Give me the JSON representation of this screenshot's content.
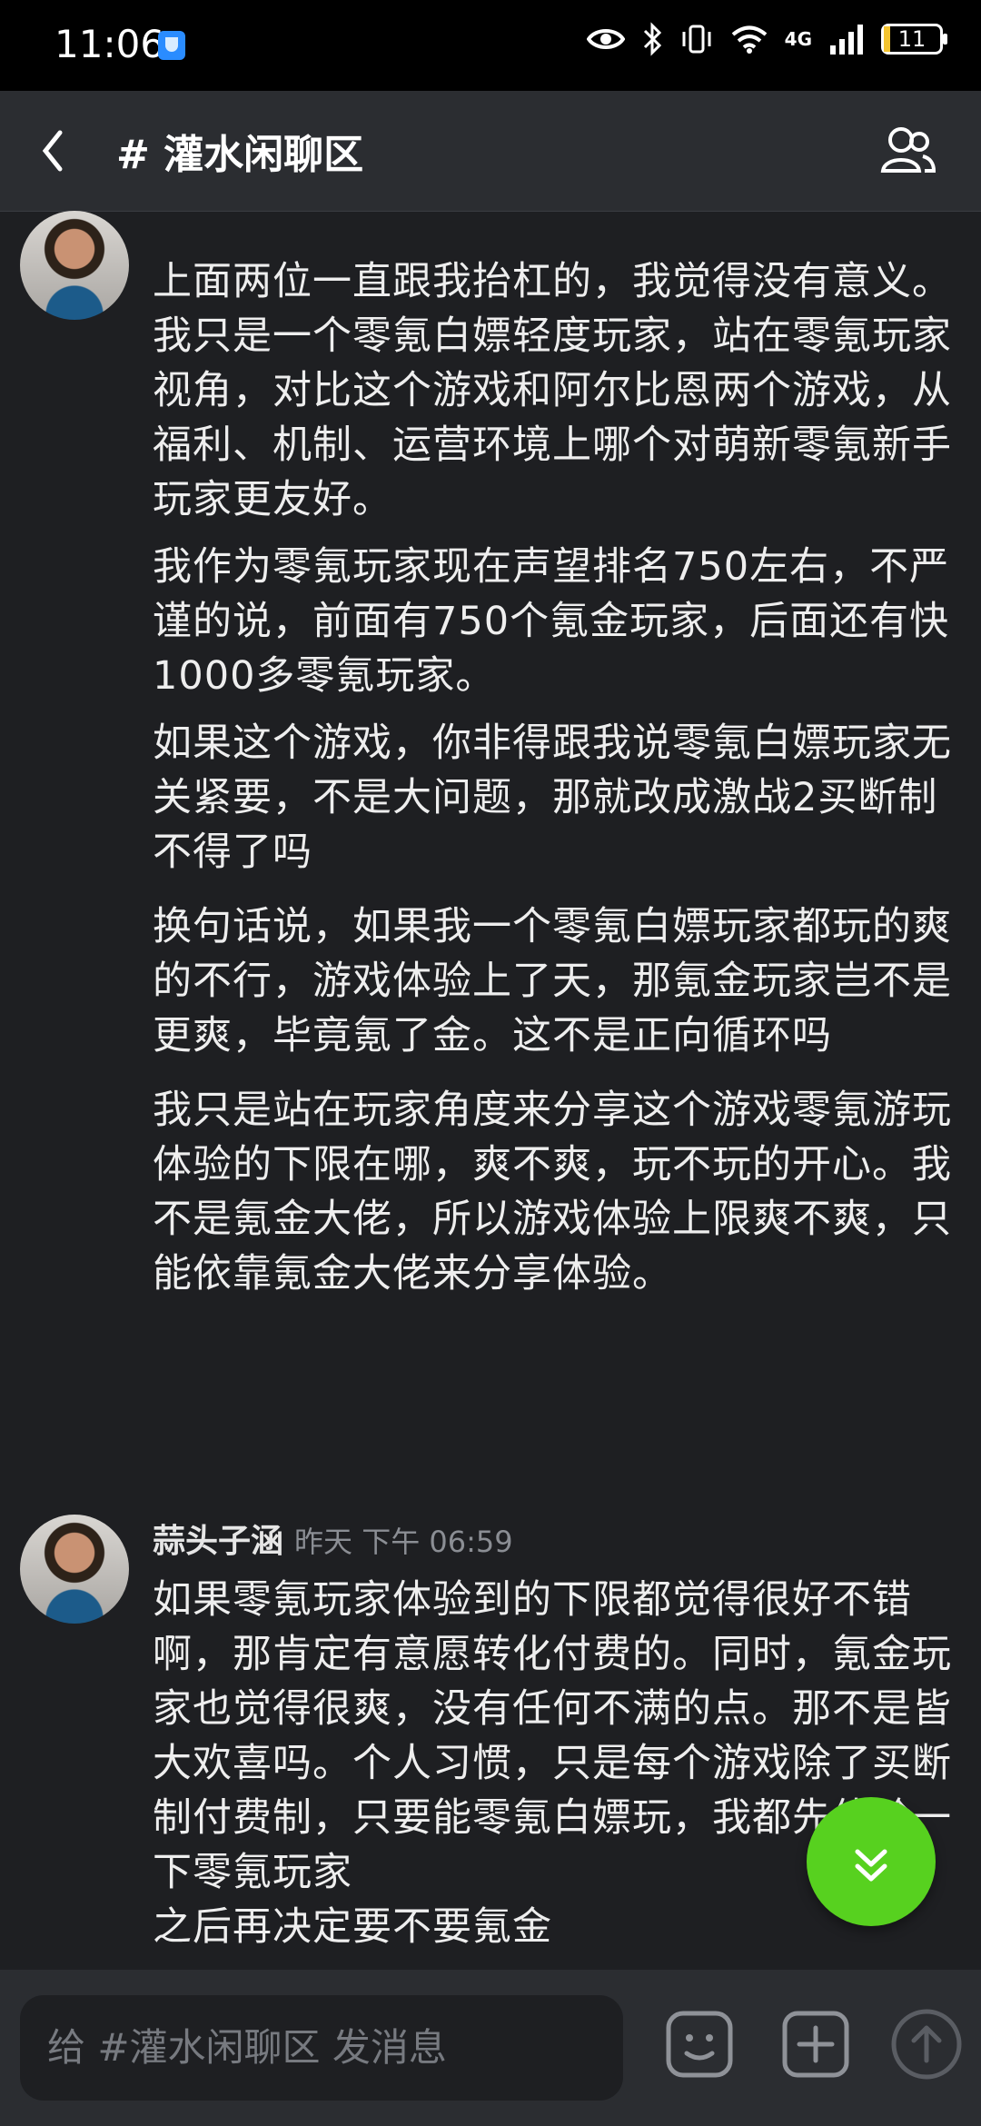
{
  "status": {
    "time": "11:06",
    "network": "4G",
    "battery": "11"
  },
  "header": {
    "title": "# 灌水闲聊区"
  },
  "messages": [
    {
      "paragraphs": [
        "上面两位一直跟我抬杠的，我觉得没有意义。我只是一个零氪白嫖轻度玩家，站在零氪玩家视角，对比这个游戏和阿尔比恩两个游戏，从福利、机制、运营环境上哪个对萌新零氪新手玩家更友好。",
        "我作为零氪玩家现在声望排名750左右，不严谨的说，前面有750个氪金玩家，后面还有快1000多零氪玩家。",
        "如果这个游戏，你非得跟我说零氪白嫖玩家无关紧要，不是大问题，那就改成激战2买断制不得了吗",
        "换句话说，如果我一个零氪白嫖玩家都玩的爽的不行，游戏体验上了天，那氪金玩家岂不是更爽，毕竟氪了金。这不是正向循环吗",
        "我只是站在玩家角度来分享这个游戏零氪游玩体验的下限在哪，爽不爽，玩不玩的开心。我不是氪金大佬，所以游戏体验上限爽不爽，只能依靠氪金大佬来分享体验。"
      ]
    },
    {
      "author": "蒜头子涵",
      "timestamp": "昨天 下午 06:59",
      "paragraphs": [
        "如果零氪玩家体验到的下限都觉得很好不错啊，那肯定有意愿转化付费的。同时，氪金玩家也觉得很爽，没有任何不满的点。那不是皆大欢喜吗。个人习惯，只是每个游戏除了买断制付费制，只要能零氪白嫖玩，我都先体验一下零氪玩家",
        "之后再决定要不要氪金"
      ]
    }
  ],
  "composer": {
    "placeholder": "给 #灌水闲聊区 发消息"
  },
  "icons": {
    "back": "chevron-left-icon",
    "members": "members-icon",
    "scroll": "chevron-double-down-icon",
    "emoji": "emoji-icon",
    "add": "plus-icon",
    "send": "arrow-up-icon"
  },
  "colors": {
    "background": "#1e1f22",
    "header": "#2b2d31",
    "fab": "#57d11f"
  }
}
